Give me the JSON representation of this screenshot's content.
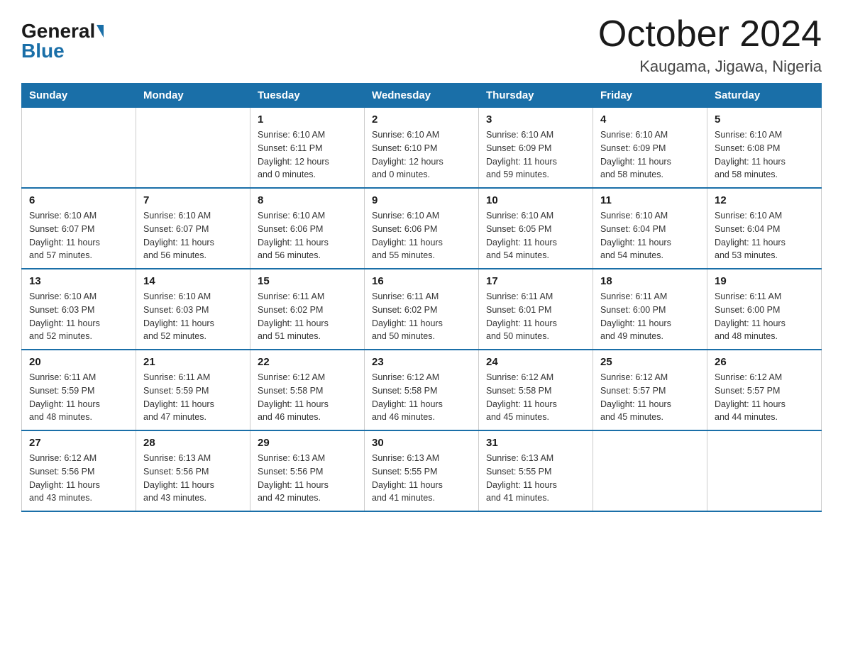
{
  "logo": {
    "general": "General",
    "blue": "Blue"
  },
  "title": "October 2024",
  "subtitle": "Kaugama, Jigawa, Nigeria",
  "days_of_week": [
    "Sunday",
    "Monday",
    "Tuesday",
    "Wednesday",
    "Thursday",
    "Friday",
    "Saturday"
  ],
  "weeks": [
    [
      {
        "day": "",
        "info": ""
      },
      {
        "day": "",
        "info": ""
      },
      {
        "day": "1",
        "info": "Sunrise: 6:10 AM\nSunset: 6:11 PM\nDaylight: 12 hours\nand 0 minutes."
      },
      {
        "day": "2",
        "info": "Sunrise: 6:10 AM\nSunset: 6:10 PM\nDaylight: 12 hours\nand 0 minutes."
      },
      {
        "day": "3",
        "info": "Sunrise: 6:10 AM\nSunset: 6:09 PM\nDaylight: 11 hours\nand 59 minutes."
      },
      {
        "day": "4",
        "info": "Sunrise: 6:10 AM\nSunset: 6:09 PM\nDaylight: 11 hours\nand 58 minutes."
      },
      {
        "day": "5",
        "info": "Sunrise: 6:10 AM\nSunset: 6:08 PM\nDaylight: 11 hours\nand 58 minutes."
      }
    ],
    [
      {
        "day": "6",
        "info": "Sunrise: 6:10 AM\nSunset: 6:07 PM\nDaylight: 11 hours\nand 57 minutes."
      },
      {
        "day": "7",
        "info": "Sunrise: 6:10 AM\nSunset: 6:07 PM\nDaylight: 11 hours\nand 56 minutes."
      },
      {
        "day": "8",
        "info": "Sunrise: 6:10 AM\nSunset: 6:06 PM\nDaylight: 11 hours\nand 56 minutes."
      },
      {
        "day": "9",
        "info": "Sunrise: 6:10 AM\nSunset: 6:06 PM\nDaylight: 11 hours\nand 55 minutes."
      },
      {
        "day": "10",
        "info": "Sunrise: 6:10 AM\nSunset: 6:05 PM\nDaylight: 11 hours\nand 54 minutes."
      },
      {
        "day": "11",
        "info": "Sunrise: 6:10 AM\nSunset: 6:04 PM\nDaylight: 11 hours\nand 54 minutes."
      },
      {
        "day": "12",
        "info": "Sunrise: 6:10 AM\nSunset: 6:04 PM\nDaylight: 11 hours\nand 53 minutes."
      }
    ],
    [
      {
        "day": "13",
        "info": "Sunrise: 6:10 AM\nSunset: 6:03 PM\nDaylight: 11 hours\nand 52 minutes."
      },
      {
        "day": "14",
        "info": "Sunrise: 6:10 AM\nSunset: 6:03 PM\nDaylight: 11 hours\nand 52 minutes."
      },
      {
        "day": "15",
        "info": "Sunrise: 6:11 AM\nSunset: 6:02 PM\nDaylight: 11 hours\nand 51 minutes."
      },
      {
        "day": "16",
        "info": "Sunrise: 6:11 AM\nSunset: 6:02 PM\nDaylight: 11 hours\nand 50 minutes."
      },
      {
        "day": "17",
        "info": "Sunrise: 6:11 AM\nSunset: 6:01 PM\nDaylight: 11 hours\nand 50 minutes."
      },
      {
        "day": "18",
        "info": "Sunrise: 6:11 AM\nSunset: 6:00 PM\nDaylight: 11 hours\nand 49 minutes."
      },
      {
        "day": "19",
        "info": "Sunrise: 6:11 AM\nSunset: 6:00 PM\nDaylight: 11 hours\nand 48 minutes."
      }
    ],
    [
      {
        "day": "20",
        "info": "Sunrise: 6:11 AM\nSunset: 5:59 PM\nDaylight: 11 hours\nand 48 minutes."
      },
      {
        "day": "21",
        "info": "Sunrise: 6:11 AM\nSunset: 5:59 PM\nDaylight: 11 hours\nand 47 minutes."
      },
      {
        "day": "22",
        "info": "Sunrise: 6:12 AM\nSunset: 5:58 PM\nDaylight: 11 hours\nand 46 minutes."
      },
      {
        "day": "23",
        "info": "Sunrise: 6:12 AM\nSunset: 5:58 PM\nDaylight: 11 hours\nand 46 minutes."
      },
      {
        "day": "24",
        "info": "Sunrise: 6:12 AM\nSunset: 5:58 PM\nDaylight: 11 hours\nand 45 minutes."
      },
      {
        "day": "25",
        "info": "Sunrise: 6:12 AM\nSunset: 5:57 PM\nDaylight: 11 hours\nand 45 minutes."
      },
      {
        "day": "26",
        "info": "Sunrise: 6:12 AM\nSunset: 5:57 PM\nDaylight: 11 hours\nand 44 minutes."
      }
    ],
    [
      {
        "day": "27",
        "info": "Sunrise: 6:12 AM\nSunset: 5:56 PM\nDaylight: 11 hours\nand 43 minutes."
      },
      {
        "day": "28",
        "info": "Sunrise: 6:13 AM\nSunset: 5:56 PM\nDaylight: 11 hours\nand 43 minutes."
      },
      {
        "day": "29",
        "info": "Sunrise: 6:13 AM\nSunset: 5:56 PM\nDaylight: 11 hours\nand 42 minutes."
      },
      {
        "day": "30",
        "info": "Sunrise: 6:13 AM\nSunset: 5:55 PM\nDaylight: 11 hours\nand 41 minutes."
      },
      {
        "day": "31",
        "info": "Sunrise: 6:13 AM\nSunset: 5:55 PM\nDaylight: 11 hours\nand 41 minutes."
      },
      {
        "day": "",
        "info": ""
      },
      {
        "day": "",
        "info": ""
      }
    ]
  ]
}
